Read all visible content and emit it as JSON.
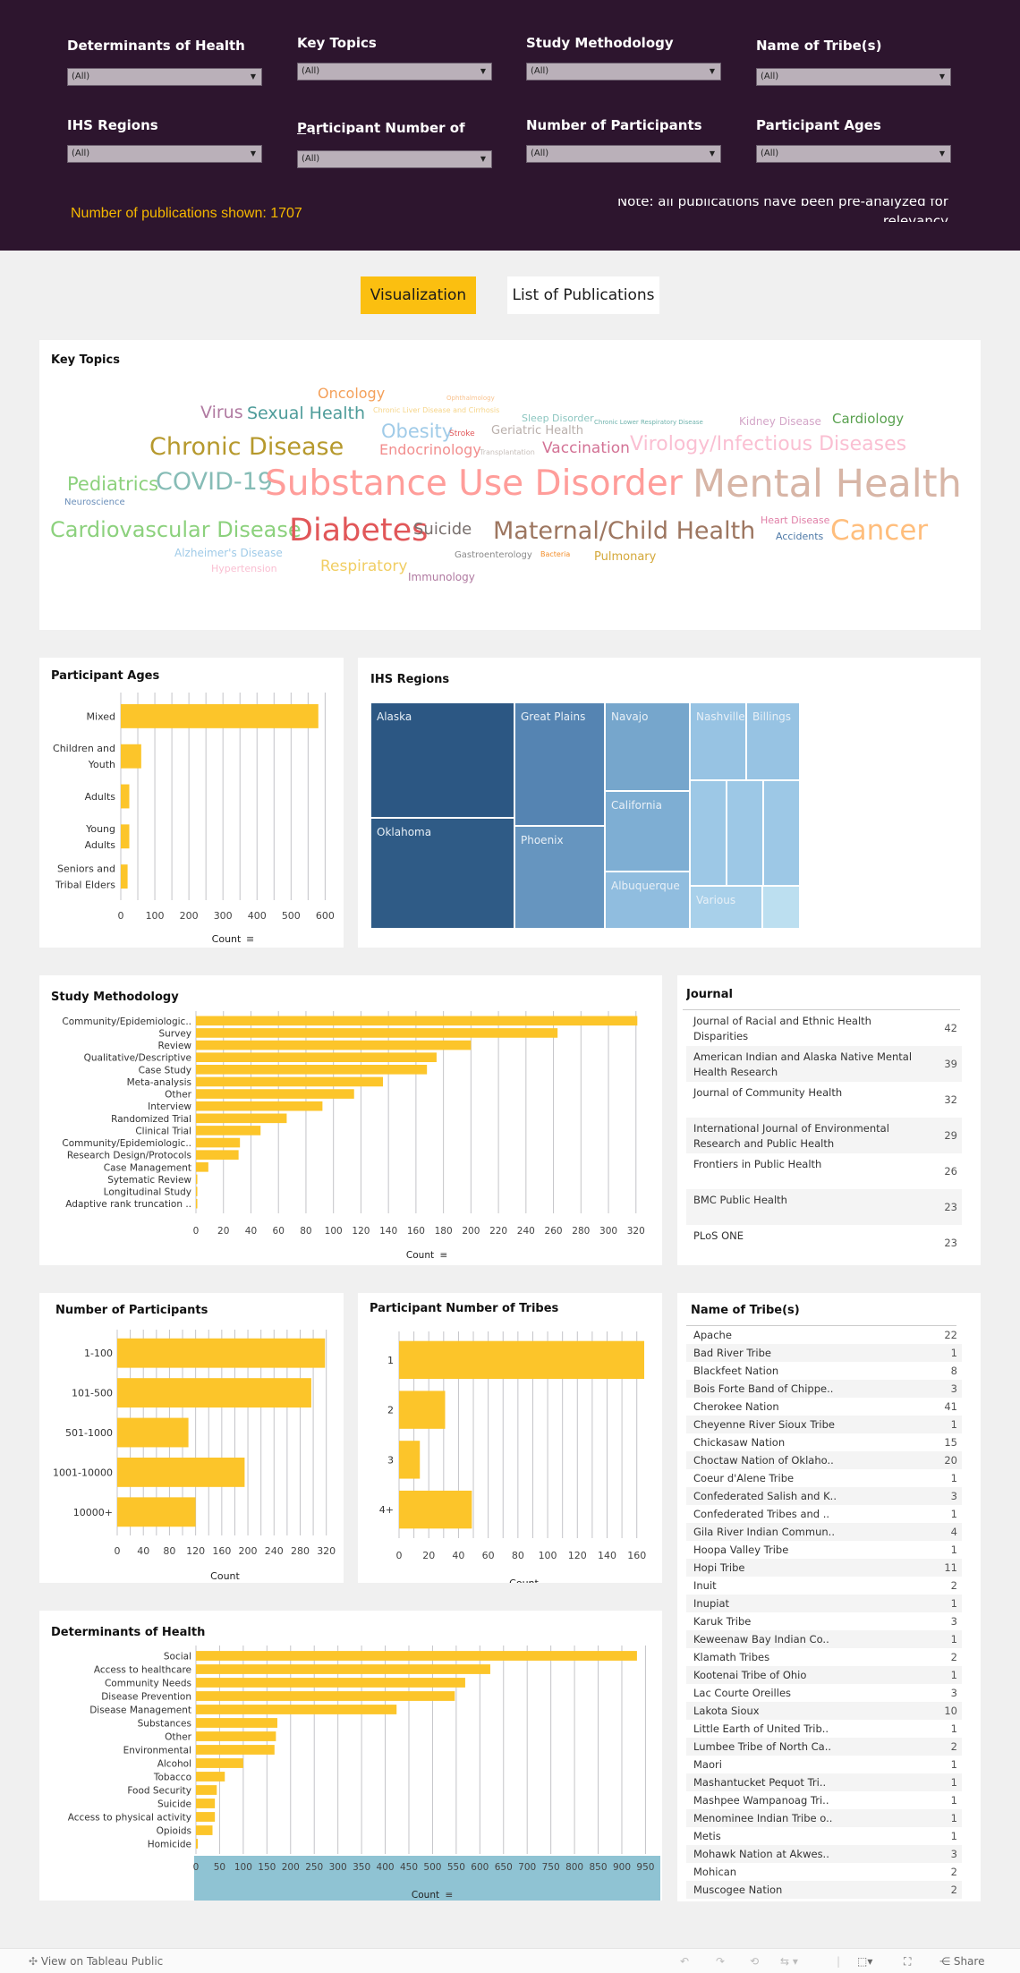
{
  "filters": [
    {
      "label": "Determinants of Health",
      "value": "(All)"
    },
    {
      "label": "Key Topics",
      "value": "(All)"
    },
    {
      "label": "Study Methodology",
      "value": "(All)"
    },
    {
      "label": "Name of Tribe(s)",
      "value": "(All)"
    },
    {
      "label": "IHS Regions",
      "value": "(All)"
    },
    {
      "label": "Participant Number of Tribes",
      "value": "(All)"
    },
    {
      "label": "Number of Participants",
      "value": "(All)"
    },
    {
      "label": "Participant Ages",
      "value": "(All)"
    }
  ],
  "header": {
    "publication_count_text": "Number of publications shown: 1707",
    "note": "Note: all publications have been pre-analyzed for relevancy"
  },
  "tabs": {
    "visualization": "Visualization",
    "list": "List of Publications"
  },
  "colors": {
    "header_bg": "#2d152e",
    "accent": "#fbbf10",
    "bar": "#fcc52a"
  },
  "key_topics": {
    "title": "Key Topics",
    "words": [
      {
        "text": "Oncology",
        "size": 16,
        "color": "#f4a05a"
      },
      {
        "text": "Ophthalmology",
        "size": 7,
        "color": "#f9c38f"
      },
      {
        "text": "Virus",
        "size": 19,
        "color": "#b07aa1"
      },
      {
        "text": "Sexual Health",
        "size": 19,
        "color": "#4e9c9a"
      },
      {
        "text": "Chronic Liver Disease and Cirrhosis",
        "size": 8,
        "color": "#f6d58a"
      },
      {
        "text": "Sleep Disorder",
        "size": 11,
        "color": "#8cc6c0"
      },
      {
        "text": "Chronic Lower Respiratory Disease",
        "size": 7,
        "color": "#6fb3ad"
      },
      {
        "text": "Kidney Disease",
        "size": 12,
        "color": "#d4a6c8"
      },
      {
        "text": "Cardiology",
        "size": 15,
        "color": "#59a14f"
      },
      {
        "text": "Obesity",
        "size": 21,
        "color": "#a0cbe8"
      },
      {
        "text": "Stroke",
        "size": 9,
        "color": "#e15759"
      },
      {
        "text": "Geriatric Health",
        "size": 13,
        "color": "#bab0ac"
      },
      {
        "text": "Chronic Disease",
        "size": 27,
        "color": "#b6992d"
      },
      {
        "text": "Endocrinology",
        "size": 16,
        "color": "#f28e8e"
      },
      {
        "text": "Transplantation",
        "size": 8,
        "color": "#c8c0bc"
      },
      {
        "text": "Vaccination",
        "size": 17,
        "color": "#d37295"
      },
      {
        "text": "Virology/Infectious Diseases",
        "size": 22,
        "color": "#fabfd2"
      },
      {
        "text": "Pediatrics",
        "size": 21,
        "color": "#8cd17d"
      },
      {
        "text": "COVID-19",
        "size": 27,
        "color": "#86bcb6"
      },
      {
        "text": "Substance Use Disorder",
        "size": 39,
        "color": "#ff9d9a"
      },
      {
        "text": "Mental Health",
        "size": 43,
        "color": "#d7b5a6"
      },
      {
        "text": "Neuroscience",
        "size": 10,
        "color": "#6b8fba"
      },
      {
        "text": "Cardiovascular Disease",
        "size": 24,
        "color": "#8cd17d"
      },
      {
        "text": "Diabetes",
        "size": 35,
        "color": "#e15759"
      },
      {
        "text": "Suicide",
        "size": 18,
        "color": "#79706e"
      },
      {
        "text": "Maternal/Child Health",
        "size": 27,
        "color": "#9d7660"
      },
      {
        "text": "Heart Disease",
        "size": 11,
        "color": "#e07fa7"
      },
      {
        "text": "Accidents",
        "size": 11,
        "color": "#4e79a7"
      },
      {
        "text": "Cancer",
        "size": 31,
        "color": "#ffbe7d"
      },
      {
        "text": "Alzheimer's Disease",
        "size": 12,
        "color": "#a0cbe8"
      },
      {
        "text": "Gastroenterology",
        "size": 10,
        "color": "#8a8a8a"
      },
      {
        "text": "Bacteria",
        "size": 8,
        "color": "#f28e2b"
      },
      {
        "text": "Pulmonary",
        "size": 13,
        "color": "#d4a83a"
      },
      {
        "text": "Hypertension",
        "size": 11,
        "color": "#fabfd2"
      },
      {
        "text": "Respiratory",
        "size": 17,
        "color": "#f1ce63"
      },
      {
        "text": "Immunology",
        "size": 12,
        "color": "#b07aa1"
      }
    ]
  },
  "ihs_regions": {
    "title": "IHS Regions",
    "cells": [
      {
        "label": "Alaska",
        "color": "#2c5783"
      },
      {
        "label": "Oklahoma",
        "color": "#2f5b86"
      },
      {
        "label": "Great Plains",
        "color": "#5584b2"
      },
      {
        "label": "Phoenix",
        "color": "#6695bf"
      },
      {
        "label": "Navajo",
        "color": "#76a6cc"
      },
      {
        "label": "California",
        "color": "#7eaed3"
      },
      {
        "label": "Albuquerque",
        "color": "#90bddf"
      },
      {
        "label": "Nashville",
        "color": "#97c3e3"
      },
      {
        "label": "Billings",
        "color": "#97c3e3"
      },
      {
        "label": "",
        "color": "#9dc8e6"
      },
      {
        "label": "",
        "color": "#9dc8e6"
      },
      {
        "label": "",
        "color": "#9dc8e6"
      },
      {
        "label": "Various",
        "color": "#a8d0ea"
      },
      {
        "label": "",
        "color": "#bcdff0"
      }
    ]
  },
  "journals": {
    "title": "Journal",
    "rows": [
      {
        "name": "Journal of Racial and Ethnic Health Disparities",
        "count": "42"
      },
      {
        "name": "American Indian and Alaska Native Mental Health Research",
        "count": "39"
      },
      {
        "name": "Journal of Community Health",
        "count": "32"
      },
      {
        "name": "International Journal of Environmental Research and Public Health",
        "count": "29"
      },
      {
        "name": "Frontiers in Public Health",
        "count": "26"
      },
      {
        "name": "BMC Public Health",
        "count": "23"
      },
      {
        "name": "PLoS ONE",
        "count": "23"
      }
    ]
  },
  "tribes": {
    "title": "Name of Tribe(s)",
    "rows": [
      {
        "name": "Apache",
        "count": "22"
      },
      {
        "name": "Bad River Tribe",
        "count": "1"
      },
      {
        "name": "Blackfeet Nation",
        "count": "8"
      },
      {
        "name": "Bois Forte Band of Chippe..",
        "count": "3"
      },
      {
        "name": "Cherokee Nation",
        "count": "41"
      },
      {
        "name": "Cheyenne River Sioux Tribe",
        "count": "1"
      },
      {
        "name": "Chickasaw Nation",
        "count": "15"
      },
      {
        "name": "Choctaw Nation of Oklaho..",
        "count": "20"
      },
      {
        "name": "Coeur d'Alene Tribe",
        "count": "1"
      },
      {
        "name": "Confederated Salish and K..",
        "count": "3"
      },
      {
        "name": "Confederated Tribes and ..",
        "count": "1"
      },
      {
        "name": "Gila River Indian Commun..",
        "count": "4"
      },
      {
        "name": "Hoopa Valley Tribe",
        "count": "1"
      },
      {
        "name": "Hopi Tribe",
        "count": "11"
      },
      {
        "name": "Inuit",
        "count": "2"
      },
      {
        "name": "Inupiat",
        "count": "1"
      },
      {
        "name": "Karuk Tribe",
        "count": "3"
      },
      {
        "name": "Keweenaw Bay Indian Co..",
        "count": "1"
      },
      {
        "name": "Klamath Tribes",
        "count": "2"
      },
      {
        "name": "Kootenai Tribe of Ohio",
        "count": "1"
      },
      {
        "name": "Lac Courte Oreilles",
        "count": "3"
      },
      {
        "name": "Lakota Sioux",
        "count": "10"
      },
      {
        "name": "Little Earth of United Trib..",
        "count": "1"
      },
      {
        "name": "Lumbee Tribe of North Ca..",
        "count": "2"
      },
      {
        "name": "Maori",
        "count": "1"
      },
      {
        "name": "Mashantucket Pequot Tri..",
        "count": "1"
      },
      {
        "name": "Mashpee Wampanoag Tri..",
        "count": "1"
      },
      {
        "name": "Menominee Indian Tribe o..",
        "count": "1"
      },
      {
        "name": "Metis",
        "count": "1"
      },
      {
        "name": "Mohawk Nation at Akwes..",
        "count": "3"
      },
      {
        "name": "Mohican",
        "count": "2"
      },
      {
        "name": "Muscogee Nation",
        "count": "2"
      }
    ]
  },
  "footer": {
    "view_on": "View on Tableau Public",
    "share": "Share"
  },
  "chart_data": [
    {
      "id": "participant_ages",
      "type": "bar",
      "title": "Participant Ages",
      "categories": [
        "Mixed",
        "Children and Youth",
        "Adults",
        "Young Adults",
        "Seniors and Tribal Elders"
      ],
      "category_lines": [
        [
          "Mixed"
        ],
        [
          "Children and",
          "Youth"
        ],
        [
          "Adults"
        ],
        [
          "Young",
          "Adults"
        ],
        [
          "Seniors and",
          "Tribal Elders"
        ]
      ],
      "values": [
        580,
        60,
        25,
        25,
        20
      ],
      "xlabel": "Count",
      "xlim": [
        0,
        620
      ],
      "ticks": [
        0,
        100,
        200,
        300,
        400,
        500,
        600
      ],
      "grid_step": 50,
      "grid": true
    },
    {
      "id": "study_methodology",
      "type": "bar",
      "title": "Study Methodology",
      "categories": [
        "Community/Epidemiologic..",
        "Survey",
        "Review",
        "Qualitative/Descriptive",
        "Case Study",
        "Meta-analysis",
        "Other",
        "Interview",
        "Randomized Trial",
        "Clinical Trial",
        "Community/Epidemiologic..",
        "Research Design/Protocols",
        "Case Management",
        "Sytematic Review",
        "Longitudinal Study",
        "Adaptive rank truncation .."
      ],
      "values": [
        321,
        263,
        200,
        175,
        168,
        136,
        115,
        92,
        66,
        47,
        32,
        31,
        9,
        1,
        1,
        1
      ],
      "xlabel": "Count",
      "xlim": [
        0,
        326
      ],
      "ticks": [
        0,
        20,
        40,
        60,
        80,
        100,
        120,
        140,
        160,
        180,
        200,
        220,
        240,
        260,
        280,
        300,
        320
      ],
      "grid_step": 20,
      "grid": true
    },
    {
      "id": "number_of_participants",
      "type": "bar",
      "title": "Number of Participants",
      "categories": [
        "1-100",
        "101-500",
        "501-1000",
        "1001-10000",
        "10000+"
      ],
      "values": [
        318,
        297,
        109,
        195,
        120
      ],
      "xlabel": "Count",
      "xlim": [
        0,
        330
      ],
      "ticks": [
        0,
        40,
        80,
        120,
        160,
        200,
        240,
        280,
        320
      ],
      "grid_step": 20,
      "grid": true
    },
    {
      "id": "participant_number_of_tribes",
      "type": "bar",
      "title": "Participant Number of Tribes",
      "categories": [
        "1",
        "2",
        "3",
        "4+"
      ],
      "values": [
        165,
        31,
        14,
        49
      ],
      "xlabel": "Count",
      "xlim": [
        0,
        168
      ],
      "ticks": [
        0,
        20,
        40,
        60,
        80,
        100,
        120,
        140,
        160
      ],
      "grid_step": 10,
      "grid": true
    },
    {
      "id": "determinants_of_health",
      "type": "bar",
      "title": "Determinants of Health",
      "categories": [
        "Social",
        "Access to healthcare",
        "Community Needs",
        "Disease Prevention",
        "Disease Management",
        "Substances",
        "Other",
        "Environmental",
        "Alcohol",
        "Tobacco",
        "Food Security",
        "Suicide",
        "Access to physical activity",
        "Opioids",
        "Homicide"
      ],
      "values": [
        932,
        622,
        569,
        547,
        424,
        172,
        169,
        166,
        100,
        61,
        44,
        40,
        40,
        35,
        4
      ],
      "xlabel": "Count",
      "xlim": [
        0,
        970
      ],
      "ticks": [
        0,
        50,
        100,
        150,
        200,
        250,
        300,
        350,
        400,
        450,
        500,
        550,
        600,
        650,
        700,
        750,
        800,
        850,
        900,
        950
      ],
      "grid_step": 50,
      "grid": true
    }
  ]
}
